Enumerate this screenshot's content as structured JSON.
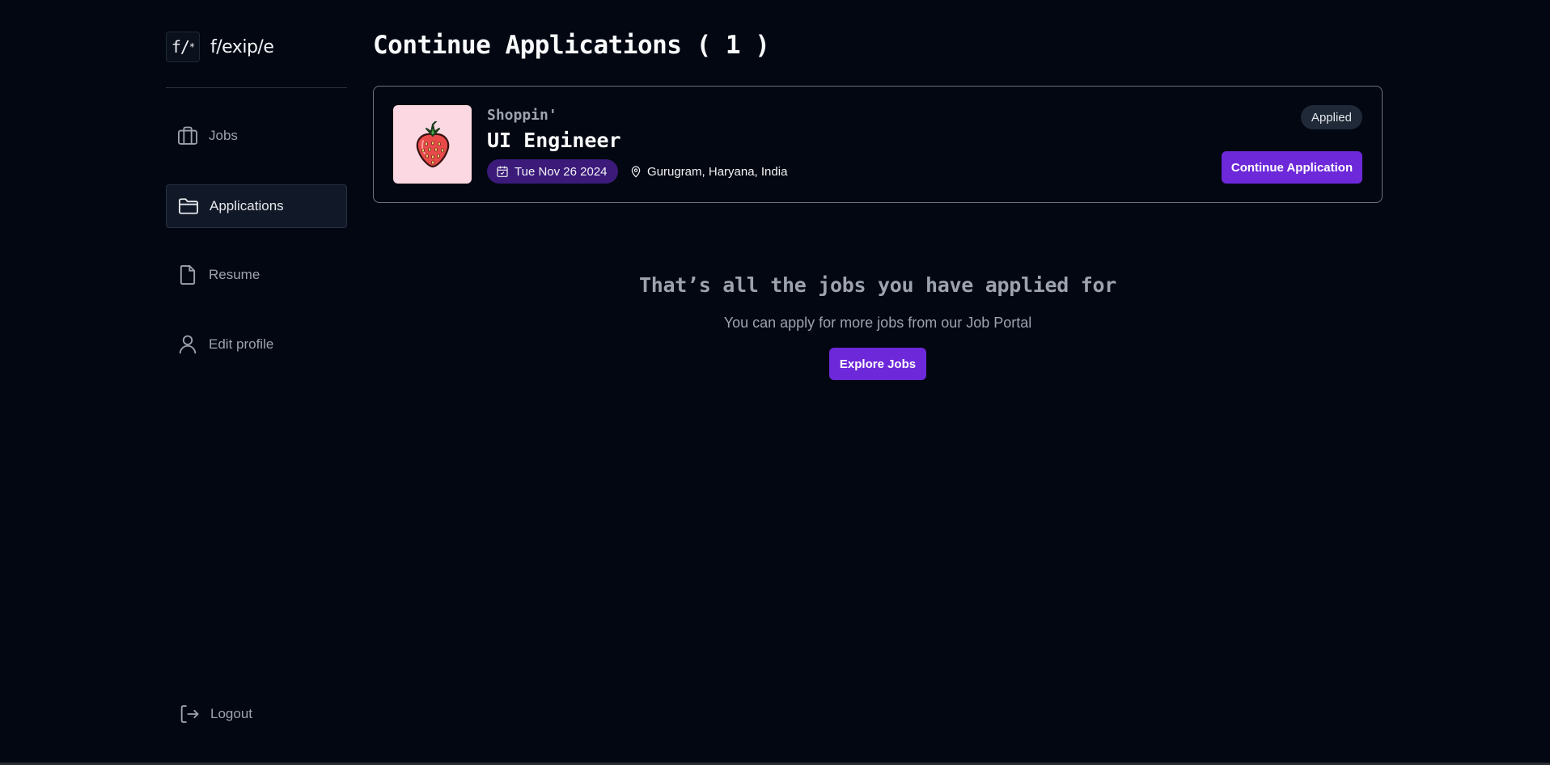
{
  "brand": {
    "logo_mark": "f/",
    "logo_mark_sub": "*",
    "name": "f/exip/e"
  },
  "sidebar": {
    "items": [
      {
        "label": "Jobs",
        "icon": "briefcase-icon",
        "active": false
      },
      {
        "label": "Applications",
        "icon": "folder-icon",
        "active": true
      },
      {
        "label": "Resume",
        "icon": "document-icon",
        "active": false
      },
      {
        "label": "Edit profile",
        "icon": "user-icon",
        "active": false
      }
    ],
    "logout_label": "Logout"
  },
  "main": {
    "title": "Continue Applications ( 1 )",
    "applications": [
      {
        "company": "Shoppin'",
        "role": "UI Engineer",
        "date": "Tue Nov 26 2024",
        "location": "Gurugram, Haryana, India",
        "status": "Applied",
        "action_label": "Continue Application",
        "logo_icon": "strawberry-icon"
      }
    ],
    "empty_state": {
      "title": "That’s all the jobs you have applied for",
      "subtitle": "You can apply for more jobs from our Job Portal",
      "button_label": "Explore Jobs"
    }
  },
  "colors": {
    "background": "#030712",
    "accent": "#6d28d9",
    "date_chip": "#3b1a7a",
    "logo_bg": "#fbd8e2"
  }
}
